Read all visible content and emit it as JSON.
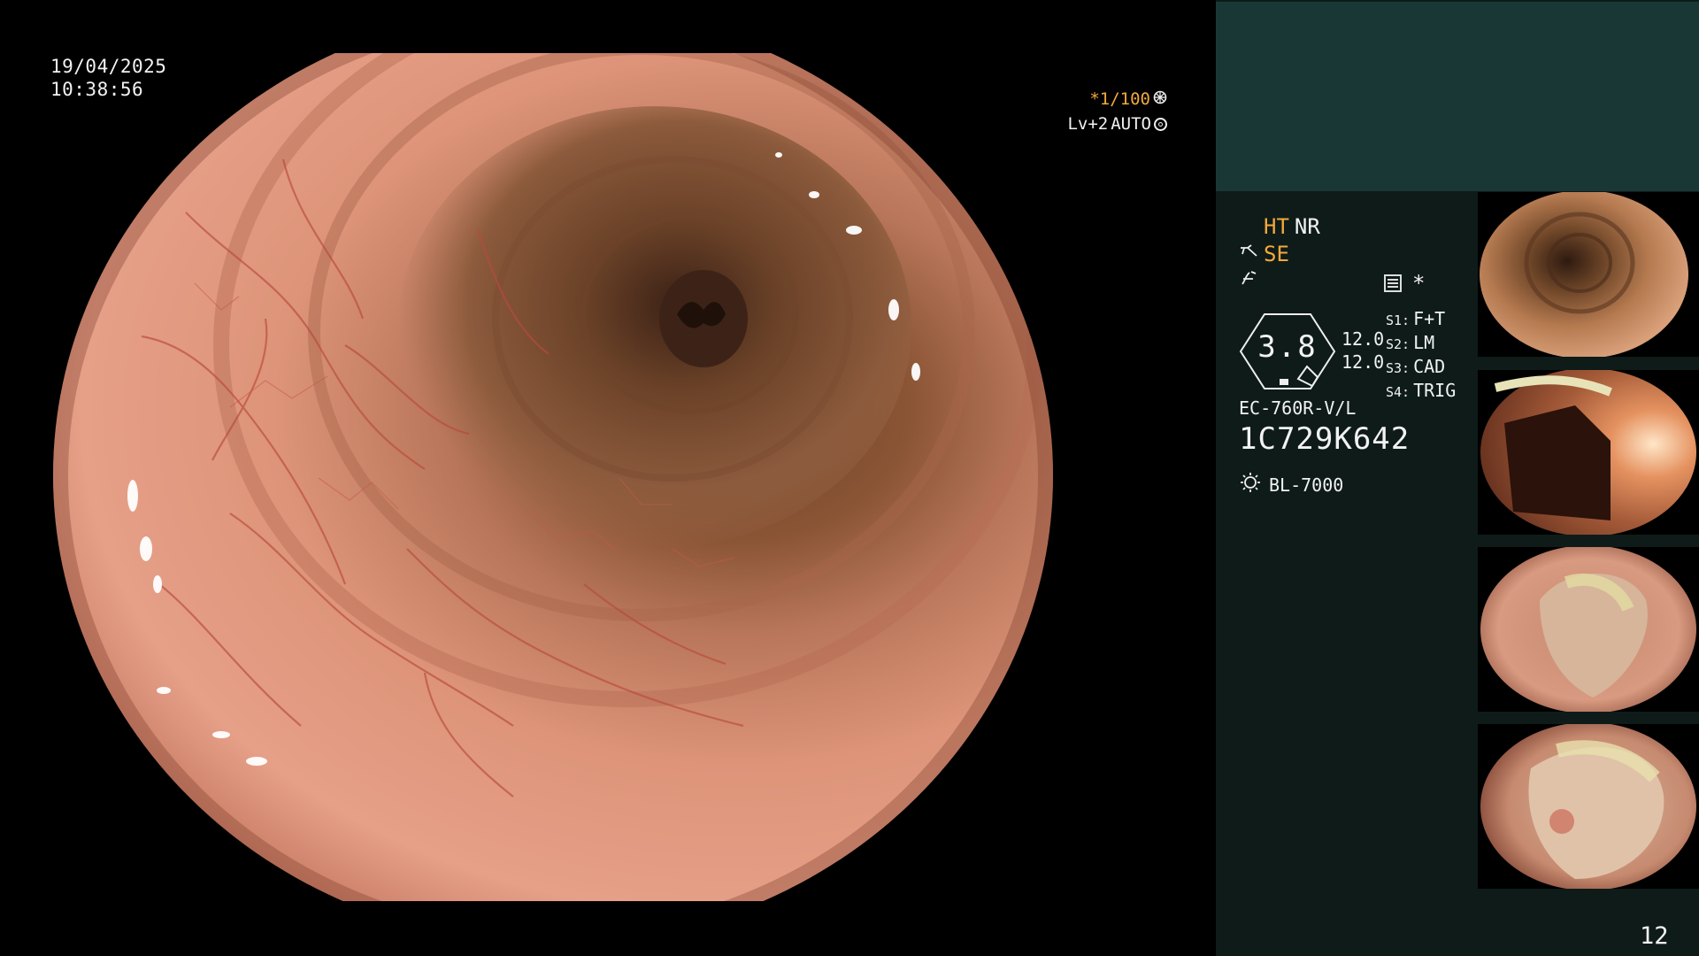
{
  "overlay": {
    "date": "19/04/2025",
    "time": "10:38:56",
    "shutter": "*1/100",
    "level": "Lv+2",
    "iris_mode": "AUTO"
  },
  "panel": {
    "status_line1_a": "HT",
    "status_line1_b": "NR",
    "status_line2": "SE",
    "mode_star": "*",
    "hex_value": "3.8",
    "level_top": "12.0",
    "level_bottom": "12.0",
    "switches": [
      {
        "key": "S1:",
        "value": "F+T"
      },
      {
        "key": "S2:",
        "value": "LM"
      },
      {
        "key": "S3:",
        "value": "CAD"
      },
      {
        "key": "S4:",
        "value": "TRIG"
      }
    ],
    "scope_model": "EC-760R-V/L",
    "serial": "1C729K642",
    "light_source": "BL-7000",
    "page_number": "12"
  },
  "icons": [
    "gear-icon",
    "ring-icon",
    "scope-tip-icon",
    "enhance-icon",
    "mode-box-icon",
    "light-bulb-icon"
  ],
  "colors": {
    "accent": "#f3a93a",
    "panel_bg": "#0e1b19",
    "panel_top_bg": "#193835",
    "mucosa": "#d98a72",
    "lumen": "#5a3826"
  }
}
